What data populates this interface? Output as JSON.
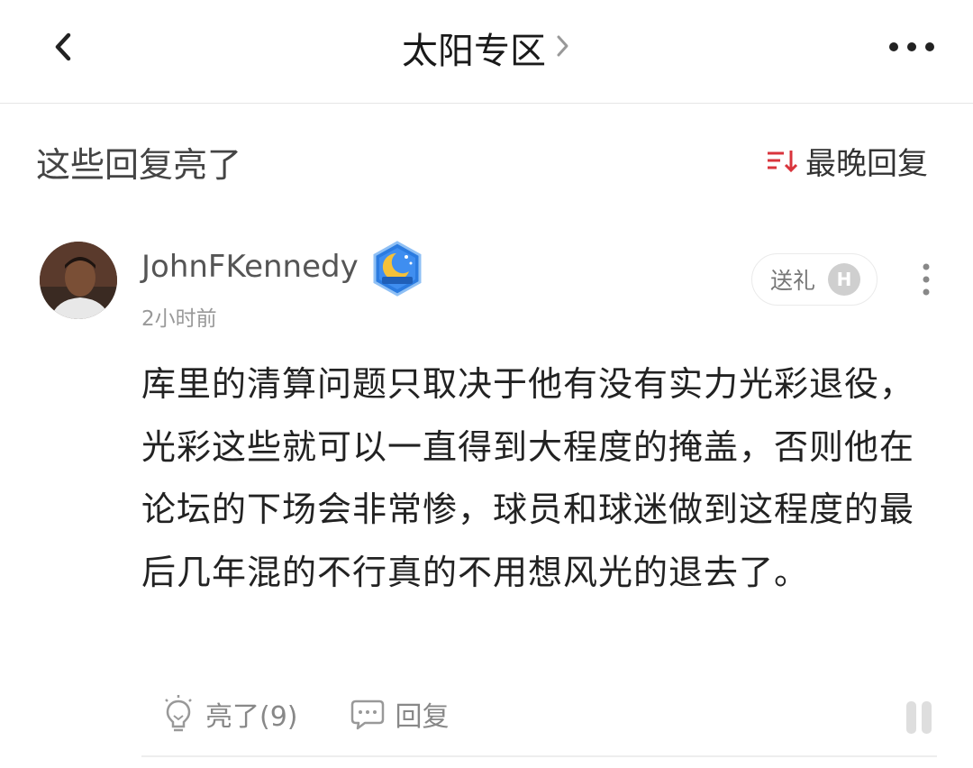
{
  "header": {
    "title": "太阳专区",
    "back_icon": "chevron-left-icon",
    "more_icon": "more-horizontal-icon"
  },
  "section": {
    "title": "这些回复亮了",
    "sort_label": "最晚回复",
    "sort_icon": "sort-icon",
    "sort_icon_color": "#d9343c"
  },
  "post": {
    "username": "JohnFKennedy",
    "badge_icon": "moon-badge-icon",
    "timestamp": "2小时前",
    "gift_label": "送礼",
    "gift_badge": "H",
    "content": "库里的清算问题只取决于他有没有实力光彩退役，光彩这些就可以一直得到大程度的掩盖，否则他在论坛的下场会非常惨，球员和球迷做到这程度的最后几年混的不行真的不用想风光的退去了。",
    "like_label": "亮了(9)",
    "reply_label": "回复"
  }
}
